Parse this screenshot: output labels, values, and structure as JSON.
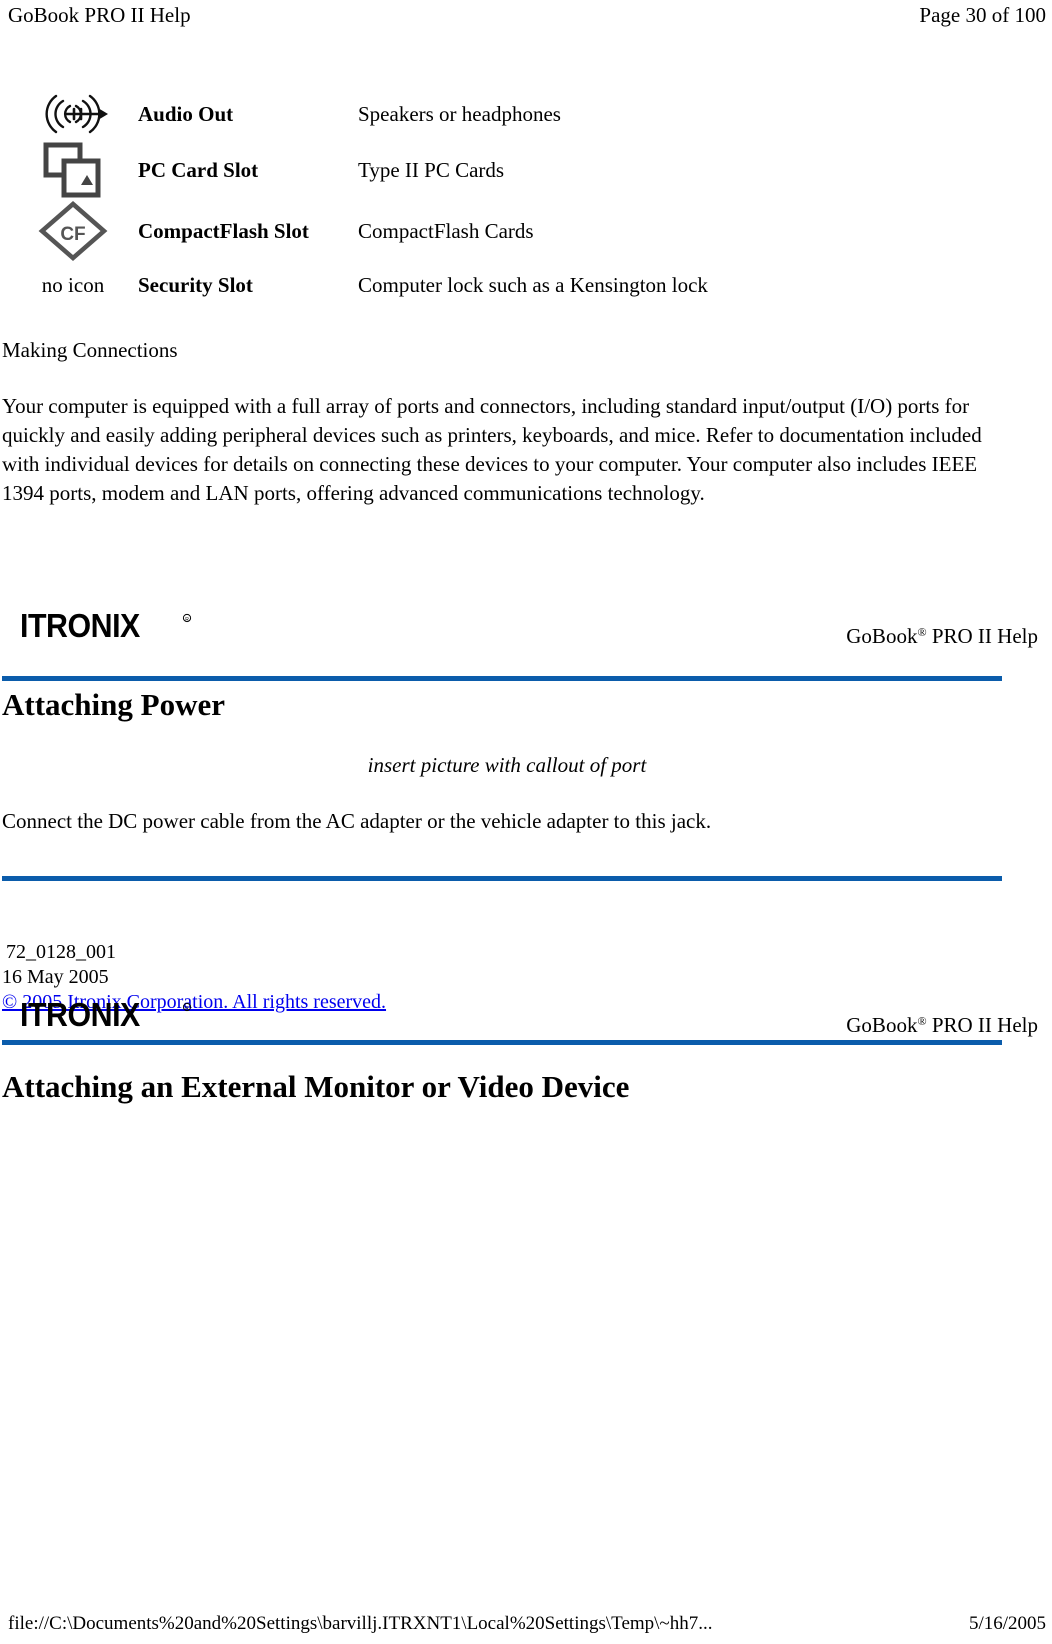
{
  "print_header": {
    "left": "GoBook PRO II Help",
    "right": "Page 30 of 100"
  },
  "port_table": {
    "rows": [
      {
        "icon": "audio-out-icon",
        "icon_label": "",
        "name": "Audio Out",
        "description": "Speakers or headphones"
      },
      {
        "icon": "pc-card-slot-icon",
        "icon_label": "",
        "name": "PC Card Slot",
        "description": "Type II PC Cards"
      },
      {
        "icon": "compactflash-slot-icon",
        "icon_label": "",
        "name": "CompactFlash Slot",
        "description": "CompactFlash Cards"
      },
      {
        "icon": "no-icon",
        "icon_label": "no icon",
        "name": "Security Slot",
        "description": "Computer lock such as a Kensington lock"
      }
    ]
  },
  "making_connections": {
    "heading": "Making Connections",
    "paragraph": "Your computer is equipped with a full array of ports and connectors, including standard input/output (I/O) ports for quickly and easily adding peripheral devices such as printers, keyboards, and mice. Refer to documentation included with individual devices for details on connecting these devices to your computer. Your computer also includes IEEE 1394 ports, modem and LAN ports, offering advanced communications technology."
  },
  "brand_band": {
    "logo_text": "ITRONIX",
    "logo_registered": "®",
    "right_label_main": "GoBook",
    "right_label_registered": "®",
    "right_label_tail": " PRO II Help",
    "rule_color": "#0b5cab"
  },
  "attaching_power": {
    "title": "Attaching Power",
    "caption": "insert picture with callout of port",
    "paragraph": "Connect the DC power cable from the AC adapter or the vehicle adapter to this jack."
  },
  "doc_meta": {
    "doc_number": "72_0128_001",
    "doc_date": "16 May 2005",
    "copyright": "© 2005 Itronix Corporation.  All rights reserved."
  },
  "next_section": {
    "title": "Attaching an External Monitor or Video Device"
  },
  "print_footer": {
    "path": "file://C:\\Documents%20and%20Settings\\barvillj.ITRXNT1\\Local%20Settings\\Temp\\~hh7...",
    "date": "5/16/2005"
  }
}
